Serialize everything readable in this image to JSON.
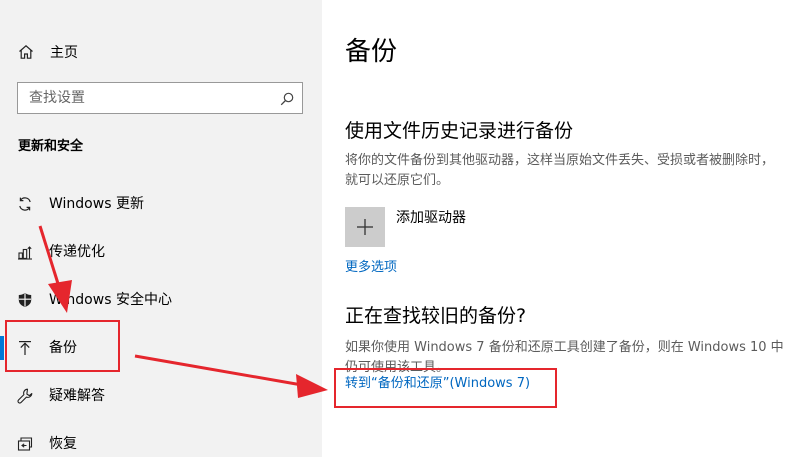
{
  "sidebar": {
    "home_label": "主页",
    "search_placeholder": "查找设置",
    "section_title": "更新和安全",
    "items": [
      {
        "label": "Windows 更新",
        "icon": "sync-icon"
      },
      {
        "label": "传递优化",
        "icon": "delivery-optimization-icon"
      },
      {
        "label": "Windows 安全中心",
        "icon": "shield-icon"
      },
      {
        "label": "备份",
        "icon": "backup-arrow-up-icon",
        "active": true
      },
      {
        "label": "疑难解答",
        "icon": "wrench-icon"
      },
      {
        "label": "恢复",
        "icon": "recovery-icon"
      }
    ]
  },
  "main": {
    "title": "备份",
    "file_history": {
      "heading": "使用文件历史记录进行备份",
      "description": "将你的文件备份到其他驱动器，这样当原始文件丢失、受损或者被删除时，就可以还原它们。",
      "add_drive_label": "添加驱动器",
      "more_options_link": "更多选项"
    },
    "older_backup": {
      "heading": "正在查找较旧的备份?",
      "description": "如果你使用 Windows 7 备份和还原工具创建了备份，则在 Windows 10 中仍可使用该工具。",
      "link": "转到“备份和还原”(Windows 7)"
    }
  },
  "colors": {
    "sidebar_bg": "#f2f2f2",
    "accent": "#0078d7",
    "link": "#0067c0",
    "annotation_red": "#e5262d",
    "add_tile": "#cccccc"
  }
}
